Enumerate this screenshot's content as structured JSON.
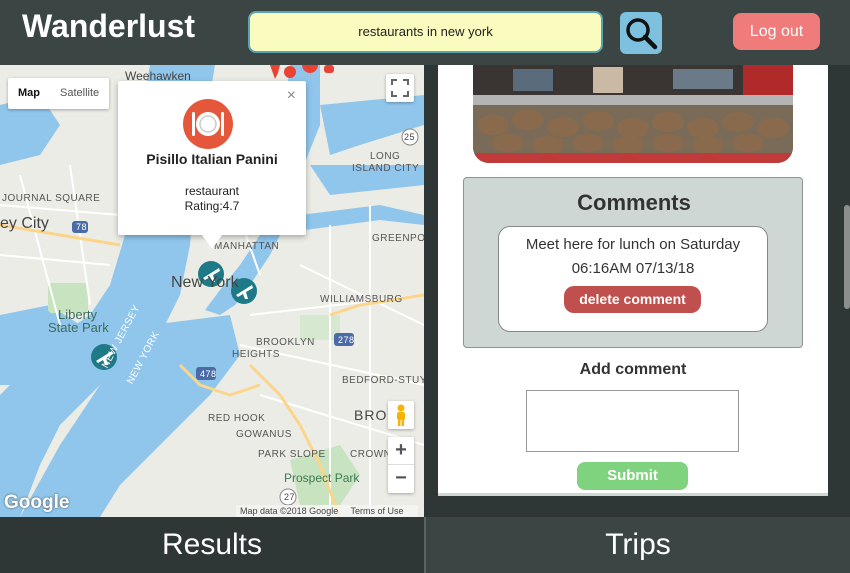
{
  "header": {
    "brand": "Wanderlust",
    "search_value": "restaurants in new york",
    "search_icon": "magnifier-icon",
    "logout_label": "Log out"
  },
  "map": {
    "map_type_active": "Map",
    "map_type_inactive": "Satellite",
    "labels": {
      "weehawken": "Weehawken",
      "journal_square": "JOURNAL SQUARE",
      "jersey_city": "ey City",
      "long_island_city": "LONG",
      "long_island_city2": "ISLAND CITY",
      "manhattan": "MANHATTAN",
      "greenpoint": "GREENPOINT",
      "new_york": "New York",
      "williamsburg": "WILLIAMSBURG",
      "liberty": "Liberty",
      "state_park": "State Park",
      "brooklyn_heights": "BROOKLYN",
      "brooklyn_heights2": "HEIGHTS",
      "new_jersey": "NEW JERSEY",
      "new_york_diag": "NEW YORK",
      "bedford": "BEDFORD-STUYV",
      "red_hook": "RED HOOK",
      "gowanus": "GOWANUS",
      "brooklyn": "BRO",
      "park_slope": "PARK SLOPE",
      "crown": "CROWN",
      "prospect_park": "Prospect Park",
      "hwy_78": "78",
      "hwy_278": "278",
      "hwy_478": "478",
      "hwy_25": "25",
      "hwy_27": "27"
    },
    "google_logo": "Google",
    "attribution_data": "Map data ©2018 Google",
    "attribution_terms": "Terms of Use",
    "zoom_in": "+",
    "zoom_out": "−"
  },
  "infowindow": {
    "name": "Pisillo Italian Panini",
    "type": "restaurant",
    "rating": "Rating:4.7",
    "close": "×",
    "icon": "restaurant-plate-icon"
  },
  "trip_panel": {
    "comments_title": "Comments",
    "comment": {
      "text": "Meet here for lunch on Saturday",
      "time": "06:16AM 07/13/18",
      "delete_label": "delete comment"
    },
    "add_comment_label": "Add comment",
    "submit_label": "Submit"
  },
  "tabs": {
    "results": "Results",
    "trips": "Trips"
  },
  "colors": {
    "header_bg": "#3b4644",
    "search_bg": "#f9fbbf",
    "search_btn": "#7dc1de",
    "logout_btn": "#f07b7b",
    "delete_btn": "#c0504d",
    "submit_btn": "#7fd37f",
    "water": "#90c6ec"
  }
}
